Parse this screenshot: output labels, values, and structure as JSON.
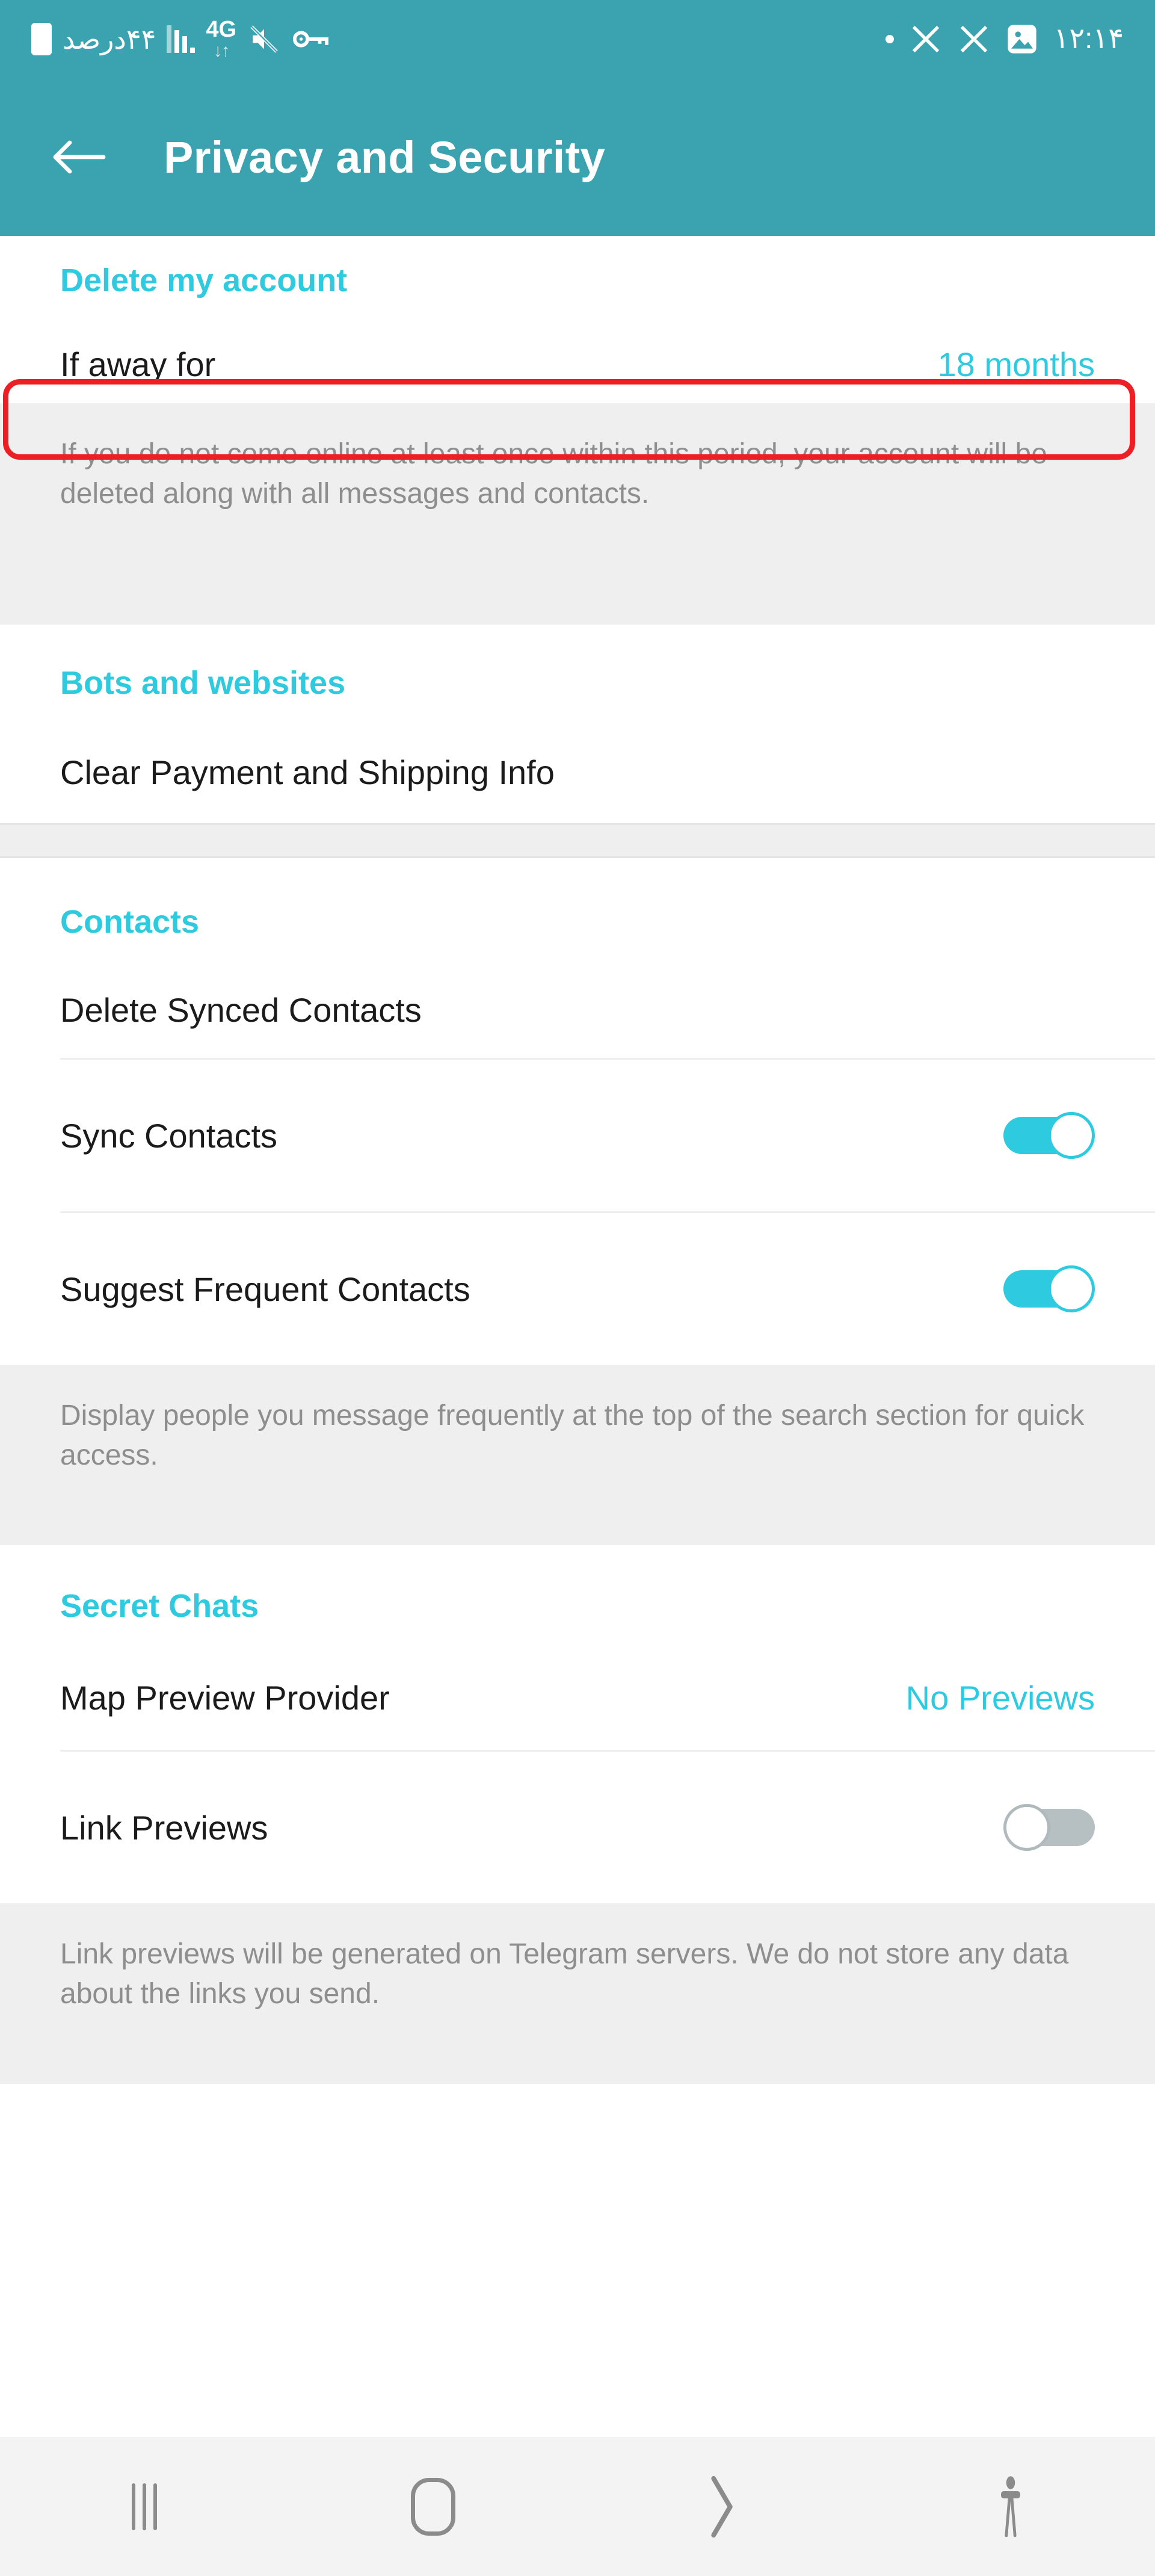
{
  "statusbar": {
    "battery_text": "۴۴درصد",
    "network_type": "4G",
    "data_arrows": "↓↑",
    "mute_icon": "volume-mute-icon",
    "vpn_icon": "key-icon",
    "signal_icon": "signal-bars-icon",
    "dot_icon": "dot-indicator-icon",
    "app_icon_1": "x-app-icon",
    "app_icon_2": "x-app-icon",
    "gallery_icon": "image-icon",
    "time": "۱۲:۱۴"
  },
  "appbar": {
    "back_icon": "back-arrow-icon",
    "title": "Privacy and Security"
  },
  "sections": {
    "delete_account": {
      "header": "Delete my account",
      "row_label": "If away for",
      "row_value": "18 months",
      "footnote": "If you do not come online at least once within this period, your account will be deleted along with all messages and contacts."
    },
    "bots_websites": {
      "header": "Bots and websites",
      "row_label": "Clear Payment and Shipping Info"
    },
    "contacts": {
      "header": "Contacts",
      "delete_synced_label": "Delete Synced Contacts",
      "sync_contacts_label": "Sync Contacts",
      "sync_contacts_state": "on",
      "suggest_frequent_label": "Suggest Frequent Contacts",
      "suggest_frequent_state": "on",
      "footnote": "Display people you message frequently at the top of the search section for quick access."
    },
    "secret_chats": {
      "header": "Secret Chats",
      "map_preview_label": "Map Preview Provider",
      "map_preview_value": "No Previews",
      "link_previews_label": "Link Previews",
      "link_previews_state": "off",
      "footnote": "Link previews will be generated on Telegram servers. We do not store any data about the links you send."
    }
  },
  "annotation": {
    "color": "#ec2024",
    "target": "If away for"
  },
  "navbar": {
    "recents_icon": "recents-icon",
    "home_icon": "home-icon",
    "back_icon": "back-chevron-icon",
    "accessibility_icon": "accessibility-person-icon"
  },
  "colors": {
    "header_bg": "#3ba2b0",
    "accent": "#2ecbe0",
    "footnote_bg": "#efefef",
    "navbar_bg": "#f3f3f3"
  }
}
